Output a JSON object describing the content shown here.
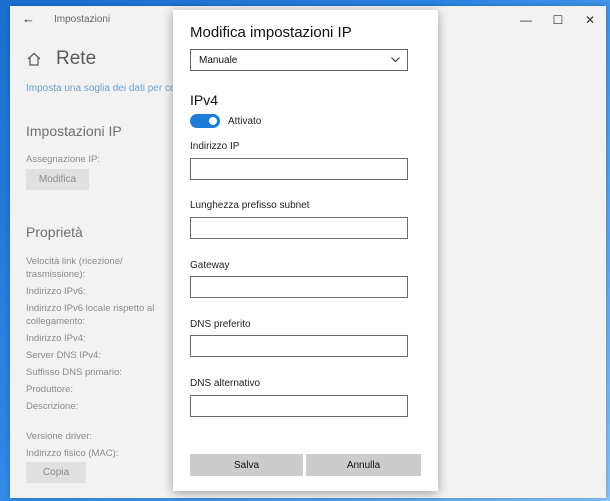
{
  "window": {
    "title": "Impostazioni",
    "back_icon": "back-arrow-icon",
    "controls": {
      "minimize": "—",
      "maximize": "☐",
      "close": "✕"
    }
  },
  "page": {
    "title": "Rete",
    "home_icon": "home-icon",
    "link": "Imposta una soglia dei dati per co"
  },
  "ip_settings": {
    "heading": "Impostazioni IP",
    "assignment_label": "Assegnazione IP:",
    "edit_button": "Modifica"
  },
  "properties": {
    "heading": "Proprietà",
    "labels": [
      "Velocità link (ricezione/",
      "trasmissione):",
      "Indirizzo IPv6:",
      "Indirizzo IPv6 locale rispetto al",
      "collegamento:",
      "Indirizzo IPv4:",
      "Server DNS IPv4:",
      "Suffisso DNS primario:",
      "Produttore:",
      "Descrizione:",
      "Versione driver:",
      "Indirizzo fisico (MAC):"
    ],
    "copy_button": "Copia"
  },
  "dialog": {
    "title": "Modifica impostazioni IP",
    "mode_select": "Manuale",
    "section": "IPv4",
    "toggle_label": "Attivato",
    "toggle_on": true,
    "accent_color": "#1e7bd6",
    "fields": [
      {
        "label": "Indirizzo IP",
        "value": ""
      },
      {
        "label": "Lunghezza prefisso subnet",
        "value": ""
      },
      {
        "label": "Gateway",
        "value": ""
      },
      {
        "label": "DNS preferito",
        "value": ""
      },
      {
        "label": "DNS alternativo",
        "value": ""
      }
    ],
    "save_button": "Salva",
    "cancel_button": "Annulla"
  }
}
